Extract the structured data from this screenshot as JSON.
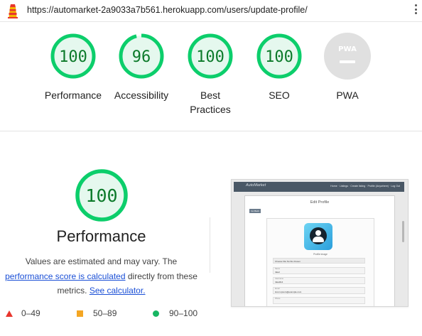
{
  "url": "https://automarket-2a9033a7b561.herokuapp.com/users/update-profile/",
  "gauges": [
    {
      "label": "Performance",
      "score": "100",
      "value": 1.0,
      "status": "pass"
    },
    {
      "label": "Accessibility",
      "score": "96",
      "value": 0.96,
      "status": "pass"
    },
    {
      "label_line1": "Best",
      "label_line2": "Practices",
      "score": "100",
      "value": 1.0,
      "status": "pass"
    },
    {
      "label": "SEO",
      "score": "100",
      "value": 1.0,
      "status": "pass"
    },
    {
      "label": "PWA",
      "badge": "PWA",
      "status": "na"
    }
  ],
  "performance": {
    "score": "100",
    "value": 1.0,
    "title": "Performance",
    "desc_prefix": "Values are estimated and may vary. The",
    "desc_link1": "performance score is calculated",
    "desc_mid": "directly from these metrics.",
    "desc_link2": "See calculator."
  },
  "legend": [
    {
      "range": "0–49",
      "shape": "triangle",
      "color": "#e8362d"
    },
    {
      "range": "50–89",
      "shape": "square",
      "color": "#f4a623"
    },
    {
      "range": "90–100",
      "shape": "circle",
      "color": "#18b663"
    }
  ],
  "thumbnail": {
    "brand": "AutoMarket",
    "nav_links": "Home · Listings · Create listing · Profile (Anywhere) · Log Out",
    "page_title": "Edit Profile",
    "back_button": "Go Back",
    "image_caption": "Profile image",
    "file_row": "Choose File   No file chosen",
    "fields": [
      {
        "label": "Name",
        "value": "Ideal"
      },
      {
        "label": "Username",
        "value": "Ideal4s1"
      },
      {
        "label": "Email",
        "value": "lorem.ipsum@example.com"
      },
      {
        "label": "Phone",
        "value": ""
      }
    ]
  },
  "colors": {
    "pass_ring": "#0cce6b",
    "pass_bg": "#e5f8ee",
    "pass_text": "#0c7a2a",
    "na_bg": "#e0e0e0",
    "na_fg": "#ffffff"
  }
}
